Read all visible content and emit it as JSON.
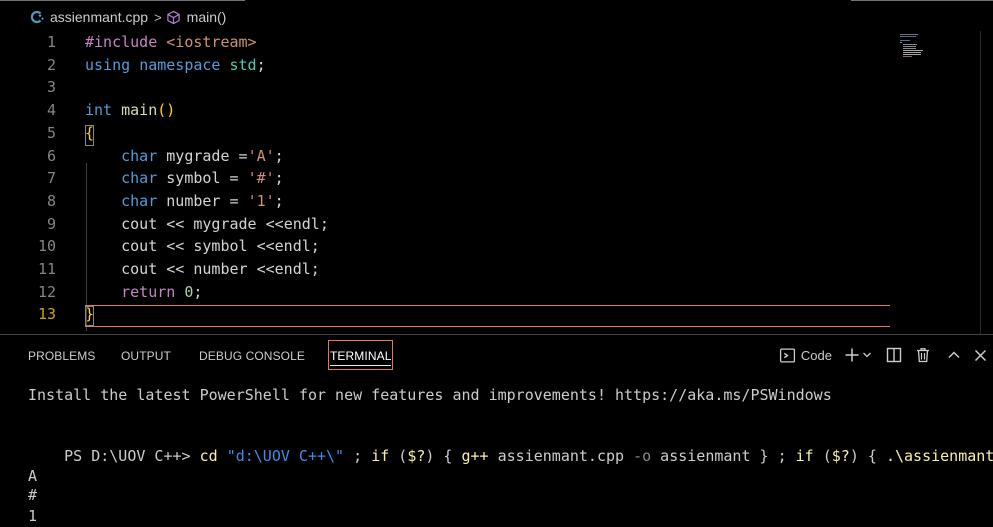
{
  "breadcrumb": {
    "file_icon": "cpp-file-icon",
    "file": "assienmant.cpp",
    "separator": ">",
    "symbol_icon": "method-cube-icon",
    "symbol": "main()"
  },
  "editor": {
    "active_line": 13,
    "line_numbers": [
      "1",
      "2",
      "3",
      "4",
      "5",
      "6",
      "7",
      "8",
      "9",
      "10",
      "11",
      "12",
      "13"
    ],
    "lines": [
      [
        {
          "t": "pre",
          "v": "#include "
        },
        {
          "t": "inc",
          "v": "<iostream>"
        }
      ],
      [
        {
          "t": "kw",
          "v": "using"
        },
        {
          "t": "plain",
          "v": " "
        },
        {
          "t": "kw",
          "v": "namespace"
        },
        {
          "t": "plain",
          "v": " "
        },
        {
          "t": "ns",
          "v": "std"
        },
        {
          "t": "plain",
          "v": ";"
        }
      ],
      [],
      [
        {
          "t": "kw",
          "v": "int"
        },
        {
          "t": "plain",
          "v": " "
        },
        {
          "t": "fn",
          "v": "main"
        },
        {
          "t": "paren",
          "v": "()"
        }
      ],
      [
        {
          "t": "brace",
          "v": "{"
        }
      ],
      [
        {
          "t": "plain",
          "v": "    "
        },
        {
          "t": "kw",
          "v": "char"
        },
        {
          "t": "plain",
          "v": " "
        },
        {
          "t": "var",
          "v": "mygrade"
        },
        {
          "t": "plain",
          "v": " ="
        },
        {
          "t": "str",
          "v": "'A'"
        },
        {
          "t": "plain",
          "v": ";"
        }
      ],
      [
        {
          "t": "plain",
          "v": "    "
        },
        {
          "t": "kw",
          "v": "char"
        },
        {
          "t": "plain",
          "v": " "
        },
        {
          "t": "var",
          "v": "symbol"
        },
        {
          "t": "plain",
          "v": " = "
        },
        {
          "t": "str",
          "v": "'#'"
        },
        {
          "t": "plain",
          "v": ";"
        }
      ],
      [
        {
          "t": "plain",
          "v": "    "
        },
        {
          "t": "kw",
          "v": "char"
        },
        {
          "t": "plain",
          "v": " "
        },
        {
          "t": "var",
          "v": "number"
        },
        {
          "t": "plain",
          "v": " = "
        },
        {
          "t": "str",
          "v": "'1'"
        },
        {
          "t": "plain",
          "v": ";"
        }
      ],
      [
        {
          "t": "plain",
          "v": "    "
        },
        {
          "t": "var",
          "v": "cout"
        },
        {
          "t": "plain",
          "v": " << "
        },
        {
          "t": "var",
          "v": "mygrade"
        },
        {
          "t": "plain",
          "v": " <<"
        },
        {
          "t": "var",
          "v": "endl"
        },
        {
          "t": "plain",
          "v": ";"
        }
      ],
      [
        {
          "t": "plain",
          "v": "    "
        },
        {
          "t": "var",
          "v": "cout"
        },
        {
          "t": "plain",
          "v": " << "
        },
        {
          "t": "var",
          "v": "symbol"
        },
        {
          "t": "plain",
          "v": " <<"
        },
        {
          "t": "var",
          "v": "endl"
        },
        {
          "t": "plain",
          "v": ";"
        }
      ],
      [
        {
          "t": "plain",
          "v": "    "
        },
        {
          "t": "var",
          "v": "cout"
        },
        {
          "t": "plain",
          "v": " << "
        },
        {
          "t": "var",
          "v": "number"
        },
        {
          "t": "plain",
          "v": " <<"
        },
        {
          "t": "var",
          "v": "endl"
        },
        {
          "t": "plain",
          "v": ";"
        }
      ],
      [
        {
          "t": "plain",
          "v": "    "
        },
        {
          "t": "ctl",
          "v": "return"
        },
        {
          "t": "plain",
          "v": " "
        },
        {
          "t": "num",
          "v": "0"
        },
        {
          "t": "plain",
          "v": ";"
        }
      ],
      [
        {
          "t": "brace",
          "v": "}"
        }
      ]
    ]
  },
  "panel": {
    "tabs": [
      "PROBLEMS",
      "OUTPUT",
      "DEBUG CONSOLE",
      "TERMINAL"
    ],
    "active_tab": "TERMINAL",
    "actions": {
      "terminal_icon": "terminal-icon",
      "terminal_name": "Code",
      "add_icon": "plus-icon",
      "dropdown_icon": "chevron-down-icon",
      "split_icon": "split-icon",
      "trash_icon": "trash-icon",
      "maximize_icon": "chevron-up-icon",
      "close_icon": "close-icon"
    }
  },
  "terminal": {
    "banner": "Install the latest PowerShell for new features and improvements! https://aka.ms/PSWindows",
    "prompt": "PS D:\\UOV C++> ",
    "command_parts": [
      {
        "t": "cmd",
        "v": "cd"
      },
      {
        "t": "w",
        "v": " "
      },
      {
        "t": "str",
        "v": "\"d:\\UOV C++\\\""
      },
      {
        "t": "w",
        "v": " ; "
      },
      {
        "t": "cmd",
        "v": "if"
      },
      {
        "t": "w",
        "v": " ("
      },
      {
        "t": "cmd",
        "v": "$?"
      },
      {
        "t": "w",
        "v": ") { "
      },
      {
        "t": "cmd",
        "v": "g++"
      },
      {
        "t": "w",
        "v": " assienmant.cpp "
      },
      {
        "t": "op",
        "v": "-o"
      },
      {
        "t": "w",
        "v": " assienmant } ; "
      },
      {
        "t": "cmd",
        "v": "if"
      },
      {
        "t": "w",
        "v": " ("
      },
      {
        "t": "cmd",
        "v": "$?"
      },
      {
        "t": "w",
        "v": ") { "
      },
      {
        "t": "cmd",
        "v": ".\\assienmant"
      },
      {
        "t": "w",
        "v": " }"
      }
    ],
    "output": [
      "A",
      "#",
      "1"
    ]
  }
}
